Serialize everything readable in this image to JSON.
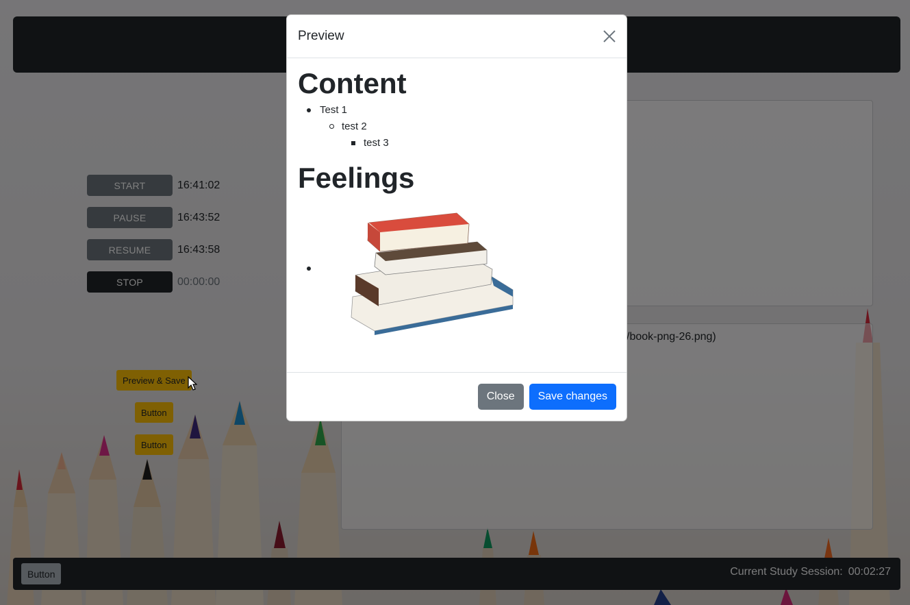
{
  "timers": [
    {
      "label": "START",
      "value": "16:41:02"
    },
    {
      "label": "PAUSE",
      "value": "16:43:52"
    },
    {
      "label": "RESUME",
      "value": "16:43:58"
    },
    {
      "label": "STOP",
      "value": "00:00:00"
    }
  ],
  "side_buttons": {
    "preview_save": "Preview & Save",
    "button1": "Button",
    "button2": "Button"
  },
  "editor": {
    "visible_text": "/book-png-26.png)"
  },
  "footer": {
    "button": "Button",
    "session_label": "Current Study Session:",
    "session_value": "00:02:27"
  },
  "modal": {
    "title": "Preview",
    "heading_content": "Content",
    "items": [
      "Test 1",
      "test 2",
      "test 3"
    ],
    "heading_feelings": "Feelings",
    "close_label": "Close",
    "save_label": "Save changes"
  },
  "colors": {
    "dark": "#212529",
    "secondary": "#6c757d",
    "warning": "#ffc107",
    "primary": "#0d6efd"
  }
}
